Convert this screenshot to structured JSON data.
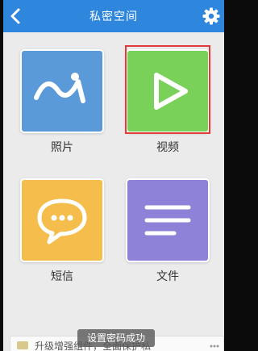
{
  "header": {
    "title": "私密空间",
    "back_icon": "back-arrow-icon",
    "settings_icon": "gear-icon"
  },
  "tiles": [
    {
      "label": "照片",
      "color": "#5b9ad9",
      "icon": "photo-icon"
    },
    {
      "label": "视频",
      "color": "#79d159",
      "icon": "play-icon"
    },
    {
      "label": "短信",
      "color": "#f5bd4c",
      "icon": "chat-bubble-icon"
    },
    {
      "label": "文件",
      "color": "#8d82d8",
      "icon": "document-lines-icon"
    }
  ],
  "toast": {
    "text": "设置密码成功"
  },
  "banner": {
    "text": "升级增强组件，全面保护私"
  },
  "colors": {
    "header": "#2e86dd",
    "highlight": "#e33a3a"
  }
}
